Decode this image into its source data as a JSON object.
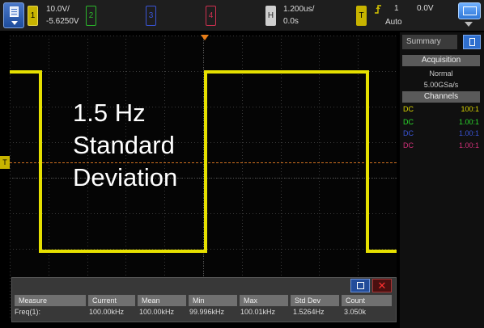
{
  "top_bar": {
    "menu_icon": "menu-doc-icon",
    "channels": [
      {
        "label": "1",
        "color": "#c8b400"
      },
      {
        "label": "2",
        "color": "#2bb82b"
      },
      {
        "label": "3",
        "color": "#3a55d8"
      },
      {
        "label": "4",
        "color": "#d03050"
      }
    ],
    "ch1_scale": "10.0V/",
    "ch1_offset": "-5.6250V",
    "horizontal_label": "H",
    "timebase": "1.200us/",
    "delay": "0.0s",
    "trigger_label": "T",
    "trigger_icon": "rising-edge-icon",
    "trigger_source": "1",
    "trigger_mode": "Auto",
    "trigger_level": "0.0V",
    "display_icon": "display-screen-icon"
  },
  "overlay": {
    "line1": "1.5 Hz",
    "line2": "Standard",
    "line3": "Deviation"
  },
  "side_panel": {
    "tab_label": "Summary",
    "tab_icon": "document-icon",
    "acquisition_header": "Acquisition",
    "acq_mode": "Normal",
    "sample_rate": "5.00GSa/s",
    "channels_header": "Channels",
    "channels": [
      {
        "coupling": "DC",
        "ratio": "100:1",
        "color": "#d9d400"
      },
      {
        "coupling": "DC",
        "ratio": "1.00:1",
        "color": "#2bd82b"
      },
      {
        "coupling": "DC",
        "ratio": "1.00:1",
        "color": "#3a55d8"
      },
      {
        "coupling": "DC",
        "ratio": "1.00:1",
        "color": "#d03078"
      }
    ]
  },
  "measurements": {
    "headers": [
      "Measure",
      "Current",
      "Mean",
      "Min",
      "Max",
      "Std Dev",
      "Count"
    ],
    "row": [
      "Freq(1):",
      "100.00kHz",
      "100.00kHz",
      "99.996kHz",
      "100.01kHz",
      "1.5264Hz",
      "3.050k"
    ]
  },
  "markers": {
    "trigger_level_label": "T"
  },
  "colors": {
    "trace": "#e6e000",
    "grid": "#3a3a3a",
    "trigger_line": "#d07020"
  }
}
